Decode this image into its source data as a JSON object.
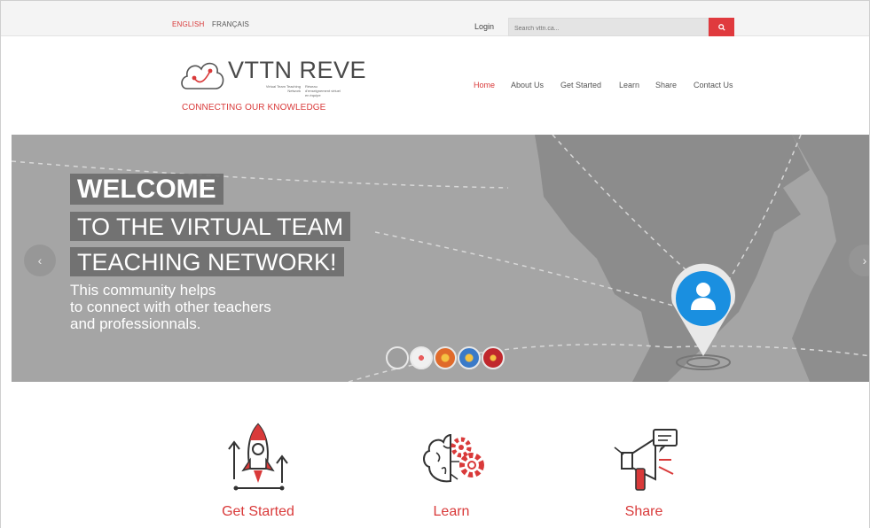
{
  "topbar": {
    "lang_en": "ENGLISH",
    "lang_fr": "FRANÇAIS",
    "login": "Login",
    "search_placeholder": "Search vttn.ca..."
  },
  "logo": {
    "title": "VTTN REVE",
    "sub_en": "Virtual Team Teaching Network",
    "sub_fr": "Réseau d'enseignement virtuel en équipe",
    "tagline": "CONNECTING OUR KNOWLEDGE"
  },
  "nav": {
    "items": [
      {
        "label": "Home",
        "active": true
      },
      {
        "label": "About Us",
        "active": false
      },
      {
        "label": "Get Started",
        "active": false
      },
      {
        "label": "Learn",
        "active": false
      },
      {
        "label": "Share",
        "active": false
      },
      {
        "label": "Contact Us",
        "active": false
      }
    ]
  },
  "hero": {
    "line1": "WELCOME",
    "line2": "TO THE VIRTUAL TEAM",
    "line3": "TEACHING NETWORK!",
    "desc1": "This community helps",
    "desc2": "to connect with other teachers",
    "desc3": "and professionnals.",
    "prev_icon": "chevron-left-icon",
    "next_icon": "chevron-right-icon",
    "slide_count": 5
  },
  "features": [
    {
      "label": "Get Started",
      "icon": "rocket-icon"
    },
    {
      "label": "Learn",
      "icon": "brain-gears-icon"
    },
    {
      "label": "Share",
      "icon": "megaphone-icon"
    }
  ],
  "colors": {
    "accent": "#d93a3a",
    "search_button": "#e03a3e",
    "hero_bg": "#a5a5a5",
    "pin_blue": "#1a8fe0"
  }
}
